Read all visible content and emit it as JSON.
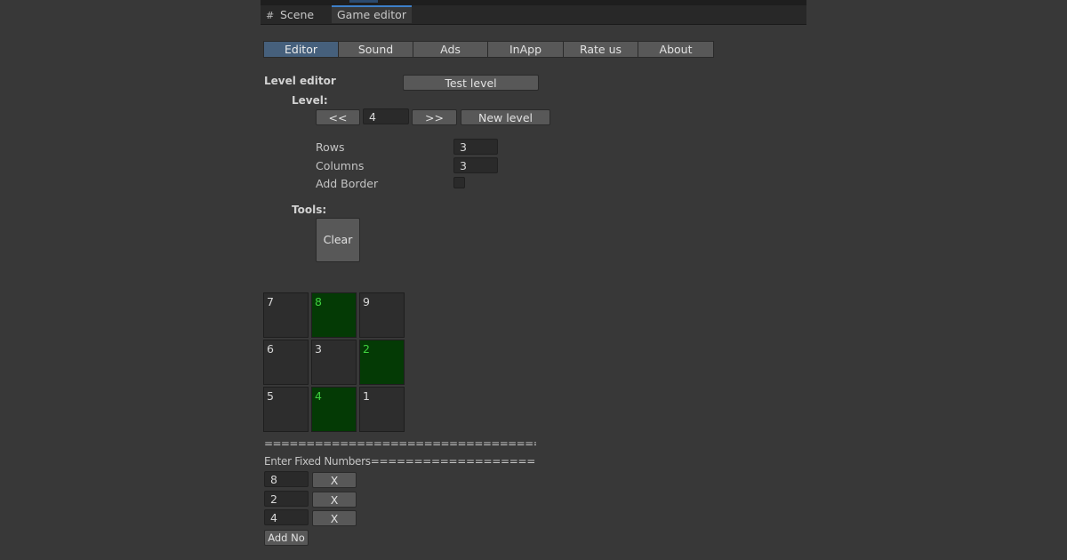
{
  "window": {
    "tabs": [
      {
        "label": "Scene",
        "icon": "grid-icon"
      },
      {
        "label": "Game editor"
      }
    ]
  },
  "toolbar": {
    "items": [
      "Editor",
      "Sound",
      "Ads",
      "InApp",
      "Rate us",
      "About"
    ],
    "active_index": 0
  },
  "level_editor": {
    "title": "Level editor",
    "test_level": "Test level",
    "level_label": "Level:",
    "prev": "<<",
    "level_value": "4",
    "next": ">>",
    "new_level": "New level"
  },
  "grid_settings": {
    "rows_label": "Rows",
    "rows_value": "3",
    "columns_label": "Columns",
    "columns_value": "3",
    "border_label": "Add Border",
    "border_checked": false
  },
  "tools": {
    "label": "Tools:",
    "clear": "Clear"
  },
  "board": {
    "cells": [
      {
        "n": "7",
        "fixed": false
      },
      {
        "n": "8",
        "fixed": true
      },
      {
        "n": "9",
        "fixed": false
      },
      {
        "n": "6",
        "fixed": false
      },
      {
        "n": "3",
        "fixed": false
      },
      {
        "n": "2",
        "fixed": true
      },
      {
        "n": "5",
        "fixed": false
      },
      {
        "n": "4",
        "fixed": true
      },
      {
        "n": "1",
        "fixed": false
      }
    ],
    "fixed_color": "#043a05",
    "fixed_text_color": "#3fd13f"
  },
  "fixed_numbers": {
    "separator": "=========================================",
    "heading": "Enter Fixed Numbers========================",
    "entries": [
      "8",
      "2",
      "4"
    ],
    "remove_label": "X",
    "add_label": "Add No"
  }
}
